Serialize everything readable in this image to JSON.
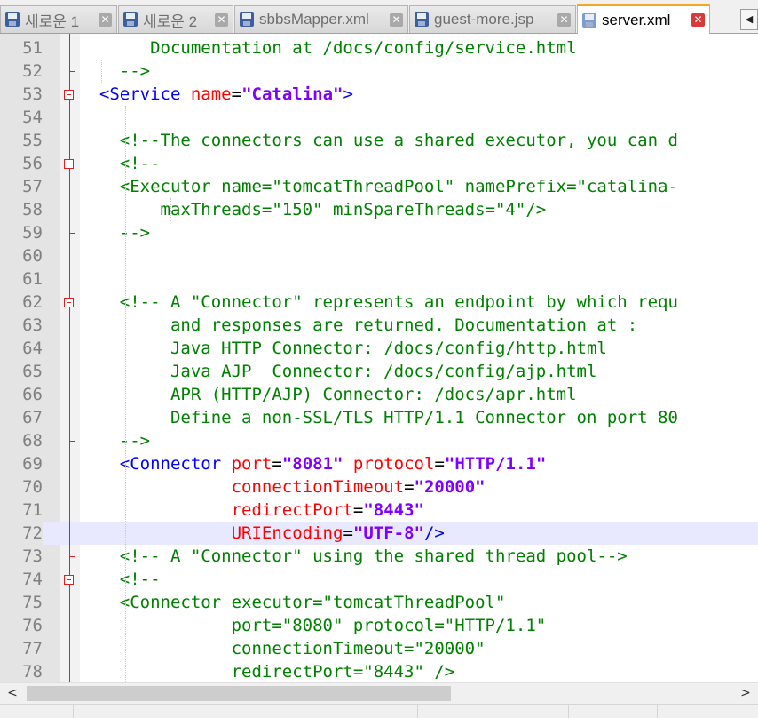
{
  "tabs": [
    {
      "label": "새로운 1",
      "active": false
    },
    {
      "label": "새로운 2",
      "active": false
    },
    {
      "label": "sbbsMapper.xml",
      "active": false
    },
    {
      "label": "guest-more.jsp",
      "active": false
    },
    {
      "label": "server.xml",
      "active": true
    }
  ],
  "icons": {
    "tab_file": "save-disk-icon",
    "tab_close": "close-icon",
    "tab_scroll_left": "chevron-left-icon",
    "scroll_left": "chevron-left-icon",
    "scroll_right": "chevron-right-icon",
    "fold": "fold-minus-icon"
  },
  "glyphs": {
    "close": "✕",
    "tab_scroll_left": "◀",
    "scroll_left": "<",
    "scroll_right": ">"
  },
  "colors": {
    "tag": "#0000ff",
    "attribute": "#ff0000",
    "value": "#8000ff",
    "comment": "#008000",
    "active_tab_accent": "#f5a623",
    "current_line": "#e8e8ff"
  },
  "editor": {
    "current_line": 72,
    "lines": [
      {
        "n": "51",
        "tokens": [
          {
            "t": "c",
            "s": "       Documentation at /docs/config/service.html"
          }
        ]
      },
      {
        "n": "52",
        "tokens": [
          {
            "t": "c",
            "s": "    -->"
          }
        ]
      },
      {
        "n": "53",
        "tokens": [
          {
            "t": "p",
            "s": "  "
          },
          {
            "t": "k",
            "s": "<Service "
          },
          {
            "t": "a",
            "s": "name"
          },
          {
            "t": "p",
            "s": "="
          },
          {
            "t": "v",
            "s": "\"Catalina\""
          },
          {
            "t": "k",
            "s": ">"
          }
        ]
      },
      {
        "n": "54",
        "tokens": []
      },
      {
        "n": "55",
        "tokens": [
          {
            "t": "c",
            "s": "    <!--The connectors can use a shared executor, you can d"
          }
        ]
      },
      {
        "n": "56",
        "tokens": [
          {
            "t": "c",
            "s": "    <!--"
          }
        ]
      },
      {
        "n": "57",
        "tokens": [
          {
            "t": "c",
            "s": "    <Executor name=\"tomcatThreadPool\" namePrefix=\"catalina-"
          }
        ]
      },
      {
        "n": "58",
        "tokens": [
          {
            "t": "c",
            "s": "        maxThreads=\"150\" minSpareThreads=\"4\"/>"
          }
        ]
      },
      {
        "n": "59",
        "tokens": [
          {
            "t": "c",
            "s": "    -->"
          }
        ]
      },
      {
        "n": "60",
        "tokens": []
      },
      {
        "n": "61",
        "tokens": []
      },
      {
        "n": "62",
        "tokens": [
          {
            "t": "c",
            "s": "    <!-- A \"Connector\" represents an endpoint by which requ"
          }
        ]
      },
      {
        "n": "63",
        "tokens": [
          {
            "t": "c",
            "s": "         and responses are returned. Documentation at :"
          }
        ]
      },
      {
        "n": "64",
        "tokens": [
          {
            "t": "c",
            "s": "         Java HTTP Connector: /docs/config/http.html"
          }
        ]
      },
      {
        "n": "65",
        "tokens": [
          {
            "t": "c",
            "s": "         Java AJP  Connector: /docs/config/ajp.html"
          }
        ]
      },
      {
        "n": "66",
        "tokens": [
          {
            "t": "c",
            "s": "         APR (HTTP/AJP) Connector: /docs/apr.html"
          }
        ]
      },
      {
        "n": "67",
        "tokens": [
          {
            "t": "c",
            "s": "         Define a non-SSL/TLS HTTP/1.1 Connector on port 80"
          }
        ]
      },
      {
        "n": "68",
        "tokens": [
          {
            "t": "c",
            "s": "    -->"
          }
        ]
      },
      {
        "n": "69",
        "tokens": [
          {
            "t": "p",
            "s": "    "
          },
          {
            "t": "k",
            "s": "<Connector "
          },
          {
            "t": "a",
            "s": "port"
          },
          {
            "t": "p",
            "s": "="
          },
          {
            "t": "v",
            "s": "\"8081\""
          },
          {
            "t": "p",
            "s": " "
          },
          {
            "t": "a",
            "s": "protocol"
          },
          {
            "t": "p",
            "s": "="
          },
          {
            "t": "v",
            "s": "\"HTTP/1.1\""
          }
        ]
      },
      {
        "n": "70",
        "tokens": [
          {
            "t": "p",
            "s": "               "
          },
          {
            "t": "a",
            "s": "connectionTimeout"
          },
          {
            "t": "p",
            "s": "="
          },
          {
            "t": "v",
            "s": "\"20000\""
          }
        ]
      },
      {
        "n": "71",
        "tokens": [
          {
            "t": "p",
            "s": "               "
          },
          {
            "t": "a",
            "s": "redirectPort"
          },
          {
            "t": "p",
            "s": "="
          },
          {
            "t": "v",
            "s": "\"8443\""
          }
        ]
      },
      {
        "n": "72",
        "tokens": [
          {
            "t": "p",
            "s": "               "
          },
          {
            "t": "a",
            "s": "URIEncoding"
          },
          {
            "t": "p",
            "s": "="
          },
          {
            "t": "v",
            "s": "\"UTF-8\""
          },
          {
            "t": "k",
            "s": "/>"
          }
        ]
      },
      {
        "n": "73",
        "tokens": [
          {
            "t": "c",
            "s": "    <!-- A \"Connector\" using the shared thread pool-->"
          }
        ]
      },
      {
        "n": "74",
        "tokens": [
          {
            "t": "c",
            "s": "    <!--"
          }
        ]
      },
      {
        "n": "75",
        "tokens": [
          {
            "t": "c",
            "s": "    <Connector executor=\"tomcatThreadPool\""
          }
        ]
      },
      {
        "n": "76",
        "tokens": [
          {
            "t": "c",
            "s": "               port=\"8080\" protocol=\"HTTP/1.1\""
          }
        ]
      },
      {
        "n": "77",
        "tokens": [
          {
            "t": "c",
            "s": "               connectionTimeout=\"20000\""
          }
        ]
      },
      {
        "n": "78",
        "tokens": [
          {
            "t": "c",
            "s": "               redirectPort=\"8443\" />"
          }
        ]
      }
    ]
  }
}
